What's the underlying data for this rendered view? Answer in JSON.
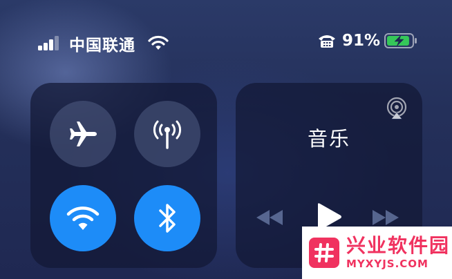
{
  "status_bar": {
    "carrier": "中国联通",
    "battery_percent": "91%",
    "battery_level": 0.91,
    "signal_bars_active": 3,
    "signal_bars_total": 4
  },
  "connectivity": {
    "airplane_mode": {
      "icon": "airplane-icon",
      "on": false
    },
    "cellular_data": {
      "icon": "antenna-icon",
      "on": false
    },
    "wifi": {
      "icon": "wifi-icon",
      "on": true
    },
    "bluetooth": {
      "icon": "bluetooth-icon",
      "on": true
    }
  },
  "music": {
    "title": "音乐",
    "controls": [
      "previous-track-icon",
      "play-icon",
      "next-track-icon"
    ],
    "airplay_icon": "airplay-icon"
  },
  "watermark": {
    "name": "兴业软件园",
    "url": "MYXYJS.COM"
  },
  "colors": {
    "accent_blue": "#1d8cf8",
    "battery_green": "#35c759",
    "watermark_pink": "#f0325f"
  }
}
